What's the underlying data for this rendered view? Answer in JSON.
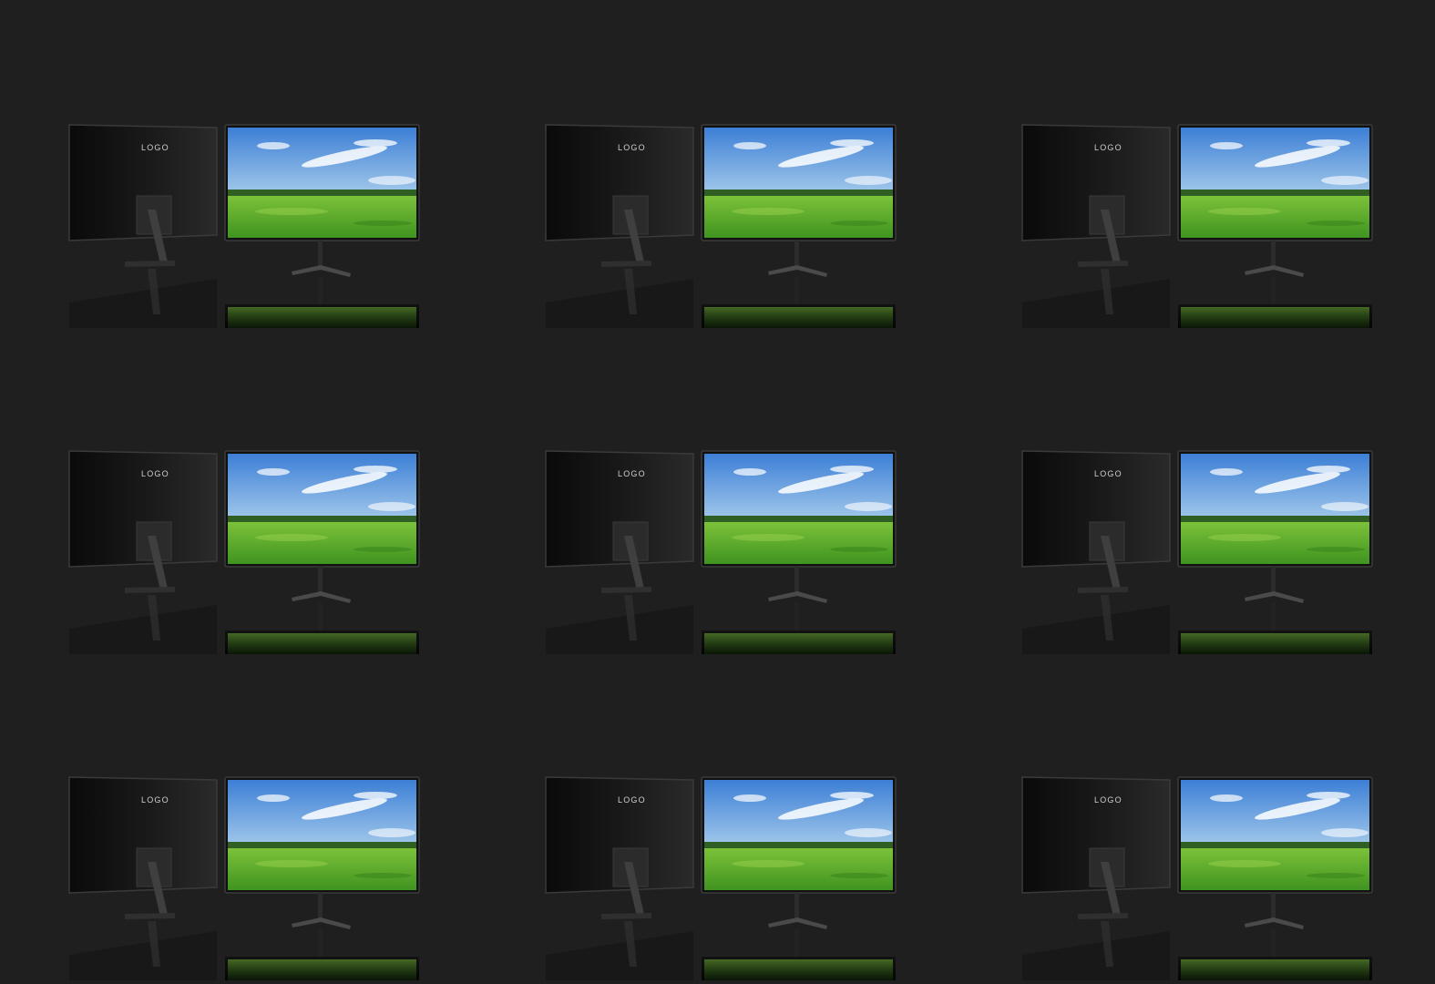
{
  "tiles": [
    {
      "logo": "LOGO"
    },
    {
      "logo": "LOGO"
    },
    {
      "logo": "LOGO"
    },
    {
      "logo": "LOGO"
    },
    {
      "logo": "LOGO"
    },
    {
      "logo": "LOGO"
    },
    {
      "logo": "LOGO"
    },
    {
      "logo": "LOGO"
    },
    {
      "logo": "LOGO"
    }
  ],
  "colors": {
    "background": "#1f1f1f",
    "sky_top": "#3d7fd6",
    "sky_bottom": "#9fc6ea",
    "grass_top": "#7cc23a",
    "grass_bottom": "#3f9420",
    "tree_line": "#2f5f22"
  }
}
